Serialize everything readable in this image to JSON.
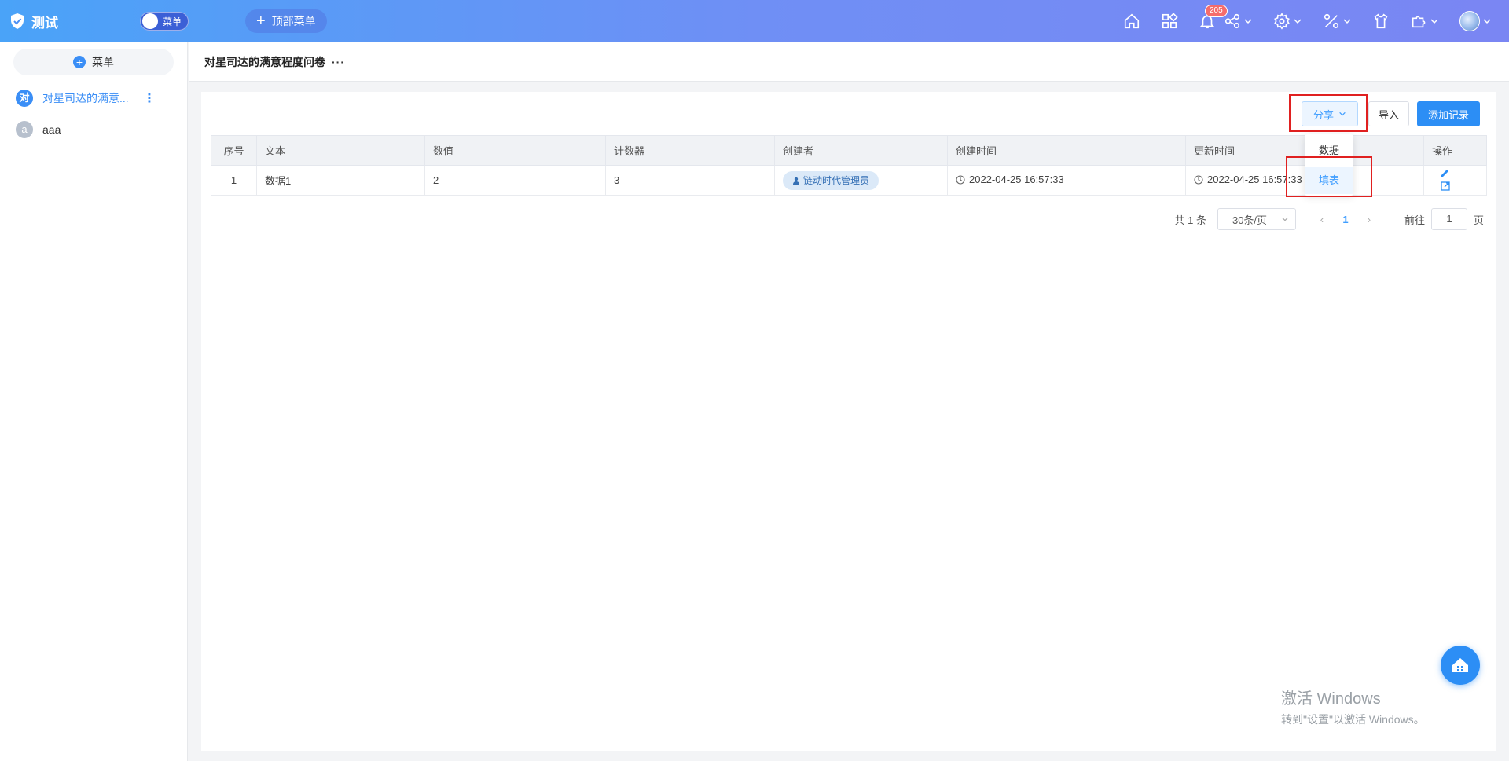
{
  "app": {
    "title": "测试",
    "toggle_label": "菜单",
    "top_menu_label": "顶部菜单",
    "notification_count": "205"
  },
  "sidebar": {
    "add_label": "菜单",
    "items": [
      {
        "avatar": "对",
        "label": "对星司达的满意...",
        "color": "#3a8ef6",
        "active": true
      },
      {
        "avatar": "a",
        "label": "aaa",
        "color": "#b7c0cd",
        "active": false
      }
    ]
  },
  "page": {
    "title": "对星司达的满意程度问卷",
    "more": "···"
  },
  "toolbar": {
    "share_label": "分享",
    "import_label": "导入",
    "add_label": "添加记录"
  },
  "share_menu": {
    "items": [
      "数据",
      "填表"
    ],
    "selected": "填表"
  },
  "table": {
    "headers": [
      "序号",
      "文本",
      "数值",
      "计数器",
      "创建者",
      "创建时间",
      "更新时间",
      "操作"
    ],
    "rows": [
      {
        "index": "1",
        "text": "数据1",
        "value": "2",
        "counter": "3",
        "creator": "链动时代管理员",
        "created": "2022-04-25 16:57:33",
        "updated": "2022-04-25 16:57:33"
      }
    ]
  },
  "pager": {
    "total": "共 1 条",
    "page_size": "30条/页",
    "current": "1",
    "goto_label": "前往",
    "goto_value": "1",
    "page_suffix": "页"
  },
  "watermark": {
    "line1": "激活 Windows",
    "line2": "转到\"设置\"以激活 Windows。"
  },
  "colors": {
    "primary": "#2c8ef5",
    "highlight": "#e02020",
    "badge": "#f56c6c"
  }
}
